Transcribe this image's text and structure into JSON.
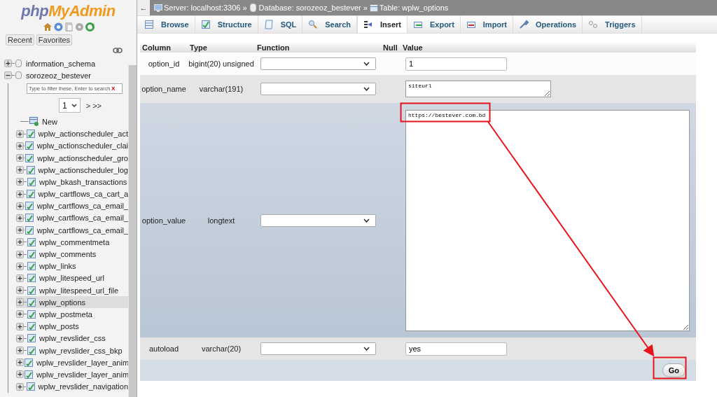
{
  "sidebar": {
    "logo": {
      "part_1": "php",
      "part_2": "MyAdmin"
    },
    "buttons": [
      "Recent",
      "Favorites"
    ],
    "databases": [
      {
        "name": "information_schema",
        "expanded": false
      },
      {
        "name": "sorozeoz_bestever",
        "expanded": true,
        "filter_placeholder": "Type to filter these, Enter to search",
        "filter_clear": "X",
        "page": "1",
        "page_nav": "> >>",
        "children": [
          {
            "name": "New",
            "kind": "new",
            "selected": false
          },
          {
            "name": "wplw_actionscheduler_act",
            "kind": "table",
            "selected": false
          },
          {
            "name": "wplw_actionscheduler_clai",
            "kind": "table",
            "selected": false
          },
          {
            "name": "wplw_actionscheduler_gro",
            "kind": "table",
            "selected": false
          },
          {
            "name": "wplw_actionscheduler_log",
            "kind": "table",
            "selected": false
          },
          {
            "name": "wplw_bkash_transactions",
            "kind": "table",
            "selected": false
          },
          {
            "name": "wplw_cartflows_ca_cart_a",
            "kind": "table",
            "selected": false
          },
          {
            "name": "wplw_cartflows_ca_email_",
            "kind": "table",
            "selected": false
          },
          {
            "name": "wplw_cartflows_ca_email_",
            "kind": "table",
            "selected": false
          },
          {
            "name": "wplw_cartflows_ca_email_",
            "kind": "table",
            "selected": false
          },
          {
            "name": "wplw_commentmeta",
            "kind": "table",
            "selected": false
          },
          {
            "name": "wplw_comments",
            "kind": "table",
            "selected": false
          },
          {
            "name": "wplw_links",
            "kind": "table",
            "selected": false
          },
          {
            "name": "wplw_litespeed_url",
            "kind": "table",
            "selected": false
          },
          {
            "name": "wplw_litespeed_url_file",
            "kind": "table",
            "selected": false
          },
          {
            "name": "wplw_options",
            "kind": "table",
            "selected": true
          },
          {
            "name": "wplw_postmeta",
            "kind": "table",
            "selected": false
          },
          {
            "name": "wplw_posts",
            "kind": "table",
            "selected": false
          },
          {
            "name": "wplw_revslider_css",
            "kind": "table",
            "selected": false
          },
          {
            "name": "wplw_revslider_css_bkp",
            "kind": "table",
            "selected": false
          },
          {
            "name": "wplw_revslider_layer_anim",
            "kind": "table",
            "selected": false
          },
          {
            "name": "wplw_revslider_layer_anim",
            "kind": "table",
            "selected": false
          },
          {
            "name": "wplw_revslider_navigation",
            "kind": "table",
            "selected": false
          }
        ]
      }
    ]
  },
  "breadcrumb": {
    "back": "←",
    "items": [
      {
        "kind": "server",
        "text": "Server: localhost:3306"
      },
      {
        "kind": "database",
        "text": "Database: sorozeoz_bestever"
      },
      {
        "kind": "table",
        "text": "Table: wplw_options"
      }
    ],
    "separator": "»"
  },
  "tabs": [
    {
      "label": "Browse",
      "selected": false
    },
    {
      "label": "Structure",
      "selected": false
    },
    {
      "label": "SQL",
      "selected": false
    },
    {
      "label": "Search",
      "selected": false
    },
    {
      "label": "Insert",
      "selected": true
    },
    {
      "label": "Export",
      "selected": false
    },
    {
      "label": "Import",
      "selected": false
    },
    {
      "label": "Operations",
      "selected": false
    },
    {
      "label": "Triggers",
      "selected": false
    }
  ],
  "form": {
    "columns": [
      "Column",
      "Type",
      "Function",
      "Null",
      "Value"
    ],
    "rows": [
      {
        "column": "option_id",
        "type": "bigint(20) unsigned",
        "kind": "input",
        "value": "1",
        "highlighted": false
      },
      {
        "column": "option_name",
        "type": "varchar(191)",
        "kind": "small-textarea",
        "value": "siteurl",
        "highlighted": false
      },
      {
        "column": "option_value",
        "type": "longtext",
        "kind": "large-textarea",
        "value": "https://bestever.com.bd",
        "highlighted": true
      },
      {
        "column": "autoload",
        "type": "varchar(20)",
        "kind": "input",
        "value": "yes",
        "highlighted": false
      }
    ],
    "submit": "Go"
  }
}
